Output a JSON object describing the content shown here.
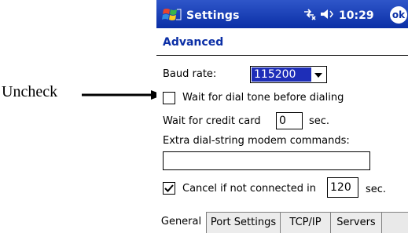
{
  "callout": {
    "label": "Uncheck"
  },
  "titlebar": {
    "title": "Settings",
    "time": "10:29",
    "ok_label": "ok",
    "colors": {
      "bar": "#0b2fa6",
      "text": "#ffffff"
    }
  },
  "page": {
    "heading": "Advanced"
  },
  "form": {
    "baud_label": "Baud rate:",
    "baud_value": "115200",
    "dial_tone_label": "Wait for dial tone before dialing",
    "dial_tone_checked": false,
    "credit_label": "Wait for credit card",
    "credit_value": "0",
    "credit_unit": "sec.",
    "extra_label": "Extra dial-string modem commands:",
    "extra_value": "",
    "cancel_label": "Cancel if not connected in",
    "cancel_checked": true,
    "cancel_value": "120",
    "cancel_unit": "sec."
  },
  "tabs": [
    {
      "label": "General",
      "active": true
    },
    {
      "label": "Port Settings",
      "active": false
    },
    {
      "label": "TCP/IP",
      "active": false
    },
    {
      "label": "Servers",
      "active": false
    }
  ]
}
